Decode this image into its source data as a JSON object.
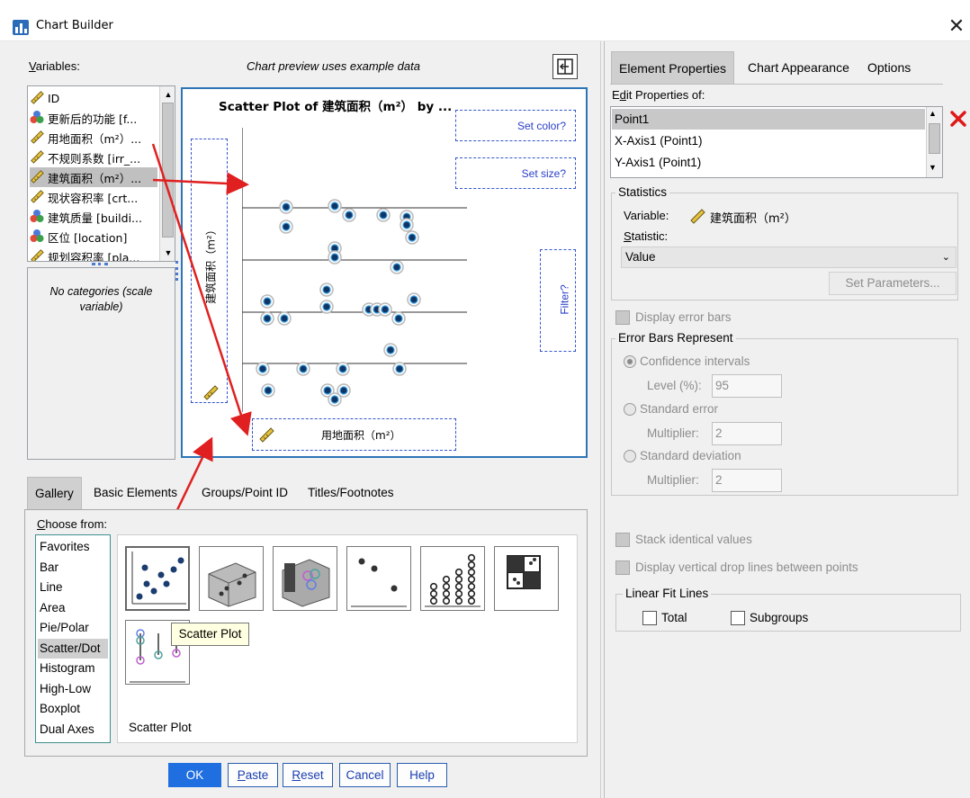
{
  "window": {
    "title": "Chart Builder",
    "close": "✕"
  },
  "left": {
    "variables_label": "Variables:",
    "preview_note": "Chart preview uses example data",
    "variables": [
      {
        "label": "ID",
        "type": "scale"
      },
      {
        "label": "更新后的功能 [f...",
        "type": "nominal"
      },
      {
        "label": "用地面积（m²）...",
        "type": "scale"
      },
      {
        "label": "不规则系数 [irr_...",
        "type": "scale"
      },
      {
        "label": "建筑面积（m²）...",
        "type": "scale",
        "selected": true
      },
      {
        "label": "现状容积率 [crt...",
        "type": "scale"
      },
      {
        "label": "建筑质量 [buildi...",
        "type": "nominal"
      },
      {
        "label": "区位 [location]",
        "type": "nominal"
      },
      {
        "label": "规划容积率 [pla...",
        "type": "scale"
      }
    ],
    "categories_note": "No categories (scale variable)"
  },
  "preview": {
    "title": "Scatter Plot of 建筑面积（m²） by ...",
    "set_color": "Set color?",
    "set_size": "Set size?",
    "filter": "Filter?",
    "y_axis_var": "建筑面积（m²）",
    "x_axis_var": "用地面积（m²）"
  },
  "gallery": {
    "tabs": [
      "Gallery",
      "Basic Elements",
      "Groups/Point ID",
      "Titles/Footnotes"
    ],
    "choose_from": "Choose from:",
    "types": [
      "Favorites",
      "Bar",
      "Line",
      "Area",
      "Pie/Polar",
      "Scatter/Dot",
      "Histogram",
      "High-Low",
      "Boxplot",
      "Dual Axes"
    ],
    "selected_type": "Scatter/Dot",
    "tooltip": "Scatter Plot",
    "caption": "Scatter Plot"
  },
  "buttons": {
    "ok": "OK",
    "paste": "Paste",
    "reset": "Reset",
    "cancel": "Cancel",
    "help": "Help"
  },
  "right": {
    "tabs": [
      "Element Properties",
      "Chart Appearance",
      "Options"
    ],
    "edit_props_label": "Edit Properties of:",
    "edit_items": [
      "Point1",
      "X-Axis1 (Point1)",
      "Y-Axis1 (Point1)"
    ],
    "statistics_title": "Statistics",
    "variable_label": "Variable:",
    "variable_value": "建筑面积（m²）",
    "statistic_label": "Statistic:",
    "statistic_value": "Value",
    "set_parameters": "Set Parameters...",
    "display_error_bars": "Display error bars",
    "error_bars_title": "Error Bars Represent",
    "ci_label": "Confidence intervals",
    "level_label": "Level (%):",
    "level_value": "95",
    "se_label": "Standard error",
    "se_mult_label": "Multiplier:",
    "se_mult_value": "2",
    "sd_label": "Standard deviation",
    "sd_mult_label": "Multiplier:",
    "sd_mult_value": "2",
    "stack_identical": "Stack identical values",
    "drop_lines": "Display vertical drop lines between points",
    "fit_lines_title": "Linear Fit Lines",
    "total_label": "Total",
    "subgroups_label": "Subgroups"
  }
}
